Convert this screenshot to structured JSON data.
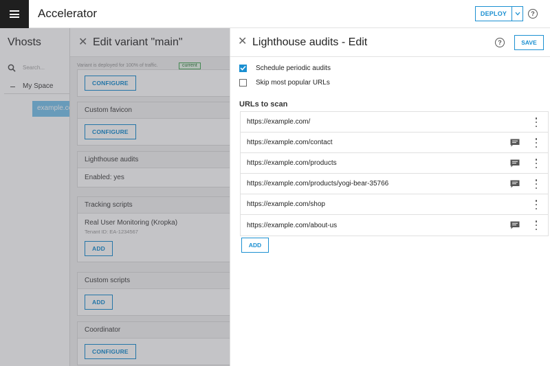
{
  "topbar": {
    "title": "Accelerator",
    "deploy_label": "DEPLOY",
    "help_glyph": "?"
  },
  "vhosts": {
    "title": "Vhosts",
    "search_placeholder": "Search...",
    "space_label": "My Space",
    "selected_host": "example.com"
  },
  "variant": {
    "title": "Edit variant \"main\"",
    "deploy_info": "Variant is deployed for 100% of traffic.",
    "status_badge": "current",
    "top_configure_label": "CONFIGURE",
    "sections": [
      {
        "title": "Custom favicon",
        "action_label": "CONFIGURE"
      },
      {
        "title": "Lighthouse audits",
        "status": "Enabled: yes"
      },
      {
        "title": "Tracking scripts",
        "item_title": "Real User Monitoring (Kropka)",
        "item_note": "Tenant ID: EA-1234567",
        "action_label": "ADD"
      },
      {
        "title": "Custom scripts",
        "action_label": "ADD"
      },
      {
        "title": "Coordinator",
        "action_label": "CONFIGURE"
      }
    ]
  },
  "panel": {
    "title": "Lighthouse audits - Edit",
    "help_glyph": "?",
    "save_label": "SAVE",
    "options": [
      {
        "label": "Schedule periodic audits",
        "checked": true
      },
      {
        "label": "Skip most popular URLs",
        "checked": false
      }
    ],
    "urls_title": "URLs to scan",
    "urls": [
      {
        "url": "https://example.com/",
        "has_comment": false
      },
      {
        "url": "https://example.com/contact",
        "has_comment": true
      },
      {
        "url": "https://example.com/products",
        "has_comment": true
      },
      {
        "url": "https://example.com/products/yogi-bear-35766",
        "has_comment": true
      },
      {
        "url": "https://example.com/shop",
        "has_comment": false
      },
      {
        "url": "https://example.com/about-us",
        "has_comment": true
      }
    ],
    "add_label": "ADD"
  },
  "colors": {
    "accent": "#1a8fd1",
    "topbar_menu_bg": "#1f1f1f",
    "badge_green": "#4aa85a"
  },
  "icons": {
    "menu": "hamburger-icon",
    "close": "close-icon",
    "help": "help-circle-icon",
    "comment": "comment-icon",
    "more": "kebab-menu-icon",
    "search": "search-icon",
    "check": "check-icon",
    "caret": "chevron-down-icon"
  }
}
